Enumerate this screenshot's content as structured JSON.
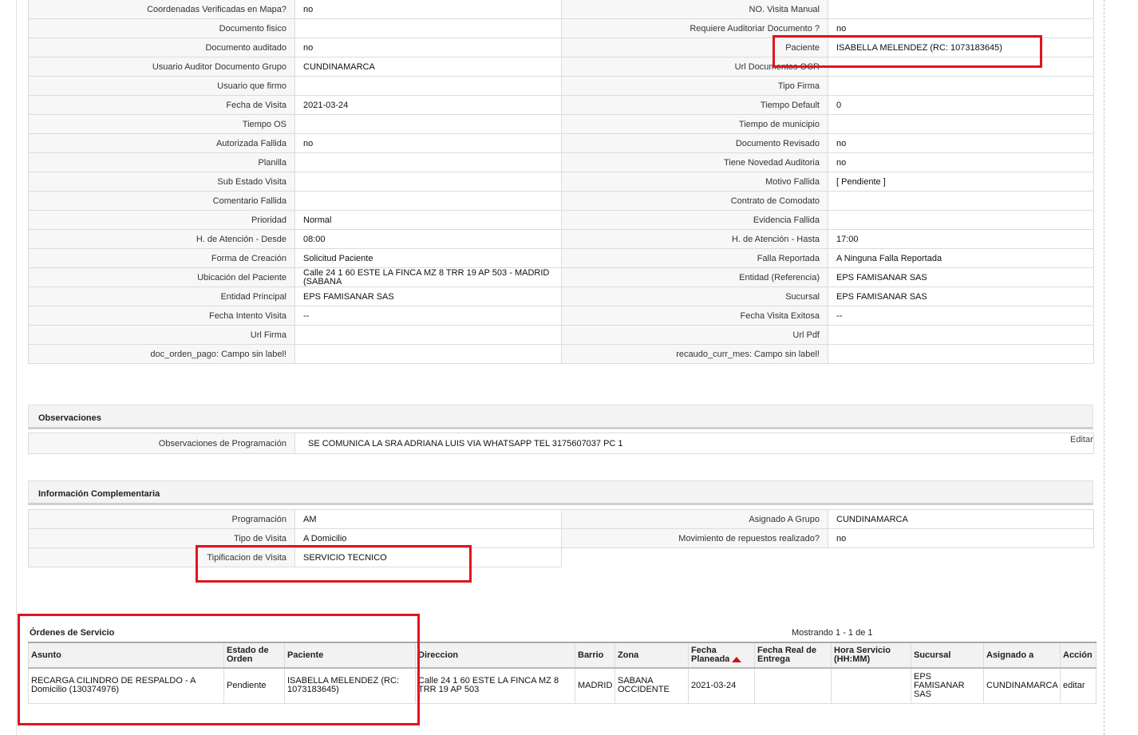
{
  "detail_rows": [
    [
      "Coordenadas Verificadas en Mapa?",
      "no",
      "NO. Visita Manual",
      ""
    ],
    [
      "Documento fisico",
      "",
      "Requiere Auditoriar Documento ?",
      "no"
    ],
    [
      "Documento auditado",
      "no",
      "Paciente",
      "ISABELLA MELENDEZ (RC: 1073183645)"
    ],
    [
      "Usuario Auditor Documento Grupo",
      "CUNDINAMARCA",
      "Url Documentos OCR",
      ""
    ],
    [
      "Usuario que firmo",
      "",
      "Tipo Firma",
      ""
    ],
    [
      "Fecha de Visita",
      "2021-03-24",
      "Tiempo Default",
      "0"
    ],
    [
      "Tiempo OS",
      "",
      "Tiempo de municipio",
      ""
    ],
    [
      "Autorizada Fallida",
      "no",
      "Documento Revisado",
      "no"
    ],
    [
      "Planilla",
      "",
      "Tiene Novedad Auditoria",
      "no"
    ],
    [
      "Sub Estado Visita",
      "",
      "Motivo Fallida",
      "[ Pendiente ]"
    ],
    [
      "Comentario Fallida",
      "",
      "Contrato de Comodato",
      ""
    ],
    [
      "Prioridad",
      "Normal",
      "Evidencia Fallida",
      ""
    ],
    [
      "H. de Atención - Desde",
      "08:00",
      "H. de Atención - Hasta",
      "17:00"
    ],
    [
      "Forma de Creación",
      "Solicitud Paciente",
      "Falla Reportada",
      "A Ninguna Falla Reportada"
    ],
    [
      "Ubicación del Paciente",
      "Calle 24 1 60 ESTE LA FINCA MZ 8 TRR 19 AP 503 - MADRID (SABANA",
      "Entidad (Referencia)",
      "EPS FAMISANAR SAS"
    ],
    [
      "Entidad Principal",
      "EPS FAMISANAR SAS",
      "Sucursal",
      "EPS FAMISANAR SAS"
    ],
    [
      "Fecha Intento Visita",
      "--",
      "Fecha Visita Exitosa",
      "--"
    ],
    [
      "Url Firma",
      "",
      "Url Pdf",
      ""
    ],
    [
      "doc_orden_pago: Campo sin label!",
      "",
      "recaudo_curr_mes: Campo sin label!",
      ""
    ]
  ],
  "observaciones": {
    "title": "Observaciones",
    "label": "Observaciones de Programación",
    "value": "SE COMUNICA LA SRA ADRIANA LUIS VIA WHATSAPP TEL 3175607037 PC 1",
    "edit_label": "Editar"
  },
  "info": {
    "title": "Información Complementaria",
    "rows": [
      [
        "Programación",
        "AM",
        "Asignado A Grupo",
        "CUNDINAMARCA"
      ],
      [
        "Tipo de Visita",
        "A Domicilio",
        "Movimiento de repuestos realizado?",
        "no"
      ],
      [
        "Tipificacion de Visita",
        "SERVICIO TECNICO"
      ]
    ]
  },
  "orders": {
    "title": "Órdenes de Servicio",
    "count": "Mostrando 1 - 1 de 1",
    "columns": [
      "Asunto",
      "Estado de Orden",
      "Paciente",
      "Direccion",
      "Barrio",
      "Zona",
      "Fecha Planeada",
      "Fecha Real de Entrega",
      "Hora Servicio (HH:MM)",
      "Sucursal",
      "Asignado a",
      "Acción"
    ],
    "rows": [
      [
        "RECARGA CILINDRO DE RESPALDO - A Domicilio (130374976)",
        "Pendiente",
        "ISABELLA MELENDEZ (RC: 1073183645)",
        "Calle 24 1 60 ESTE LA FINCA MZ 8 TRR 19 AP 503",
        "MADRID",
        "SABANA OCCIDENTE",
        "2021-03-24",
        "",
        "",
        "EPS FAMISANAR SAS",
        "CUNDINAMARCA",
        "editar"
      ]
    ]
  },
  "colors": {
    "highlight_box": "#e0141f",
    "sort_arrow": "#d01010"
  }
}
